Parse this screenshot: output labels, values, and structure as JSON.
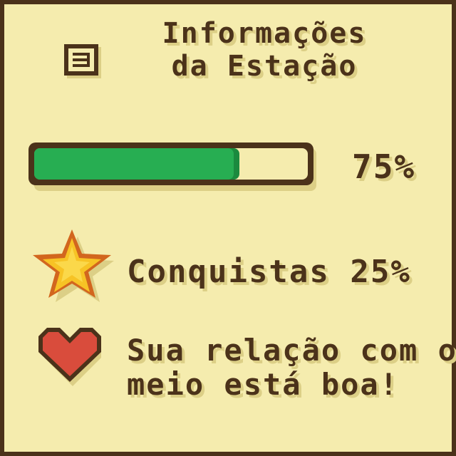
{
  "title": {
    "line1": "Informações",
    "line2": "da Estação"
  },
  "progress": {
    "percent_label": "75%",
    "fraction": 0.75,
    "fill_color": "#27ae52",
    "track_color": "#f5ecae",
    "border_color": "#4b321a"
  },
  "achievements": {
    "label": "Conquistas 25%",
    "icon": "star-icon",
    "color": "#f7c325"
  },
  "relationship": {
    "line1": "Sua relação com o",
    "line2": "meio está boa!",
    "icon": "heart-icon",
    "color": "#d94c3c"
  },
  "menu": {
    "icon": "menu-icon"
  }
}
